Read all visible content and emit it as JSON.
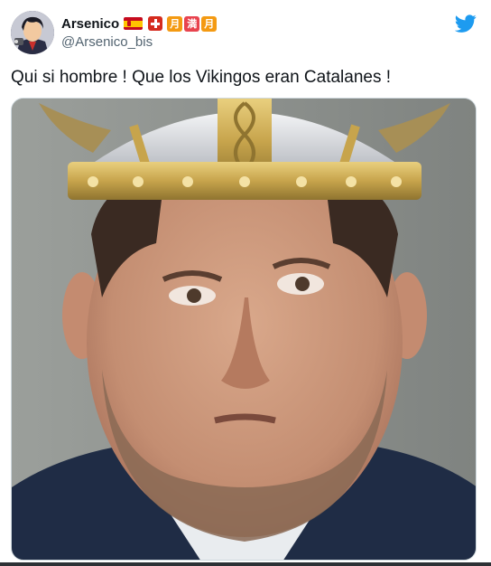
{
  "tweet": {
    "author": {
      "display_name": "Arsenico",
      "handle": "@Arsenico_bis",
      "name_emojis": [
        "spain-flag",
        "swiss-flag",
        "月",
        "満",
        "月"
      ]
    },
    "text": "Qui si hombre ! Que los Vikingos eran Catalanes !",
    "media": {
      "kind": "photo",
      "subject_icon": "viking-helmet"
    }
  },
  "colors": {
    "twitter_blue": "#1d9bf0",
    "text_primary": "#0f1419",
    "text_secondary": "#536471",
    "badge_orange": "#f49a12",
    "badge_red": "#e8434e"
  }
}
